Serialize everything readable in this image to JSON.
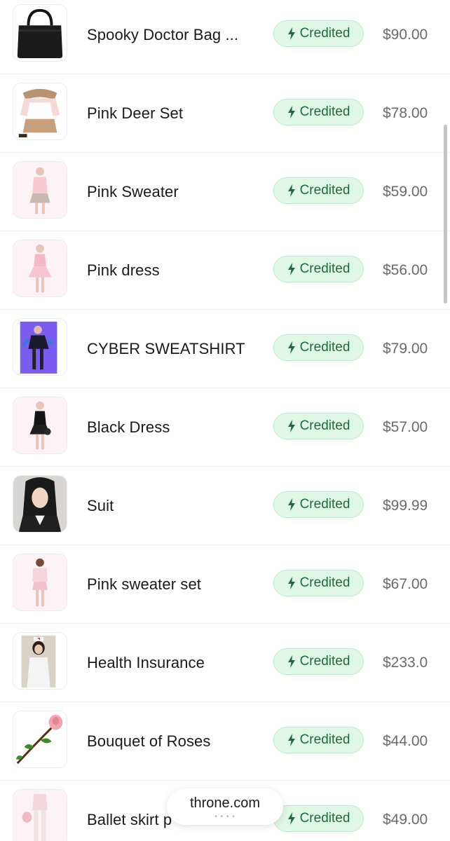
{
  "wishlist": {
    "credited_label": "Credited",
    "items": [
      {
        "name": "Spooky Doctor Bag ...",
        "price": "$90.00",
        "thumb_icon": "black-bag-icon"
      },
      {
        "name": "Pink Deer Set",
        "price": "$78.00",
        "thumb_icon": "fur-set-icon"
      },
      {
        "name": "Pink Sweater",
        "price": "$59.00",
        "thumb_icon": "model-pink-sweater-icon"
      },
      {
        "name": "Pink dress",
        "price": "$56.00",
        "thumb_icon": "model-pink-dress-icon"
      },
      {
        "name": "CYBER SWEATSHIRT",
        "price": "$79.00",
        "thumb_icon": "cyber-outfit-icon"
      },
      {
        "name": "Black Dress",
        "price": "$57.00",
        "thumb_icon": "model-black-dress-icon"
      },
      {
        "name": "Suit",
        "price": "$99.99",
        "thumb_icon": "portrait-suit-icon"
      },
      {
        "name": "Pink sweater set",
        "price": "$67.00",
        "thumb_icon": "model-pink-set-icon"
      },
      {
        "name": "Health Insurance",
        "price": "$233.0",
        "thumb_icon": "nurse-costume-icon"
      },
      {
        "name": "Bouquet of Roses",
        "price": "$44.00",
        "thumb_icon": "rose-icon"
      },
      {
        "name": "Ballet skirt p",
        "price": "$49.00",
        "thumb_icon": "ballet-skirt-icon"
      }
    ]
  },
  "browser": {
    "url": "throne.com",
    "url_subtext": "• • • •"
  },
  "colors": {
    "badge_bg": "#dff7e6",
    "badge_text": "#1f6b3c",
    "price_text": "#6a6a6a"
  }
}
